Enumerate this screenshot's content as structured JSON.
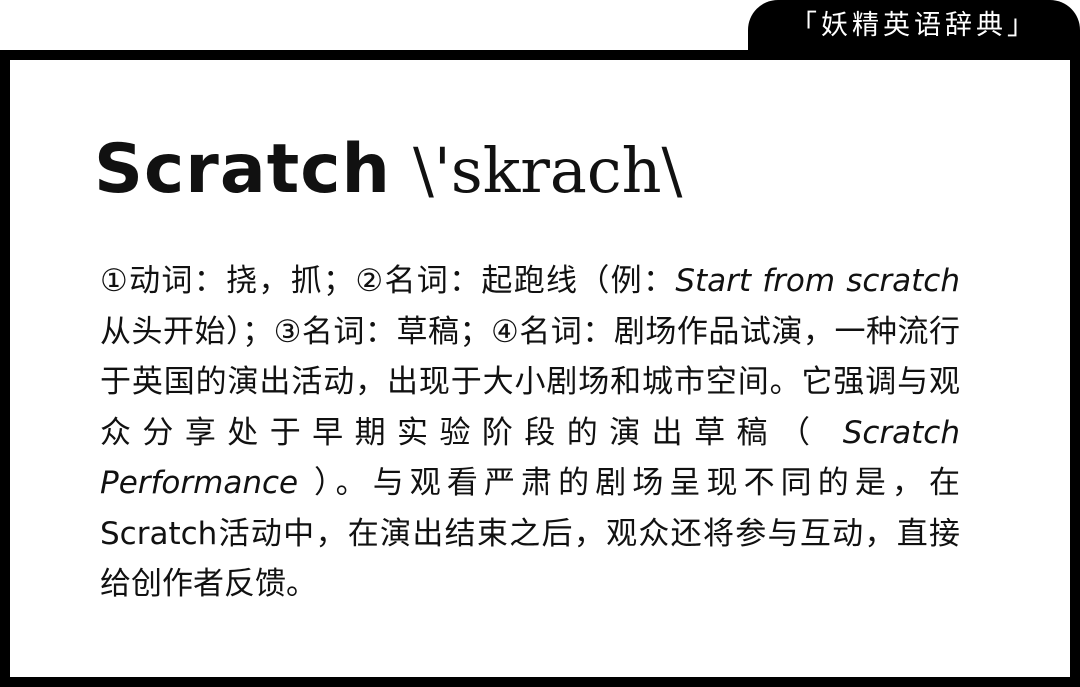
{
  "tab": {
    "label": "「妖精英语辞典」"
  },
  "entry": {
    "headword": "Scratch",
    "pronunciation": "\\'skrach\\"
  },
  "definition": {
    "p1": "①动词：挠，抓；②名词：起跑线（例：",
    "p2": "Start from scratch",
    "p3": " 从头开始）；③名词：草稿；④名词：剧场作品试演，一种流行于英国的演出活动，出现于大小剧场和城市空间。它强调与观众分享处于早期实验阶段的演出草稿（ ",
    "p4": "Scratch Performance",
    "p5": " ）。与观看严肃的剧场呈现不同的是，在Scratch活动中，在演出结束之后，观众还将参与互动，直接给创作者反馈。"
  }
}
